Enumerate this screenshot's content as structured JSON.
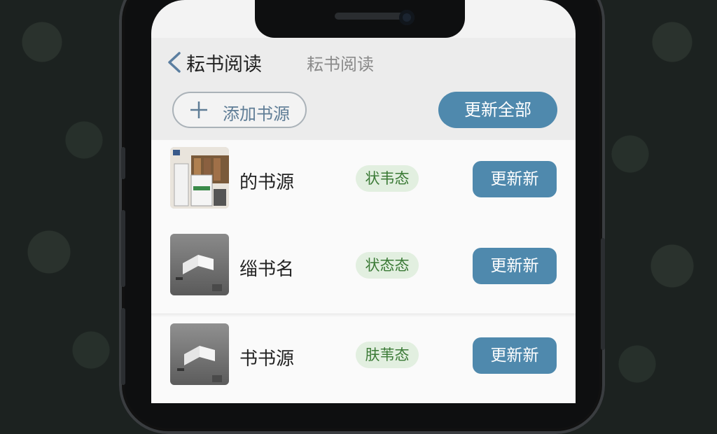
{
  "header": {
    "title": "耘书阅读",
    "subtitle": "耘书阅读",
    "back_icon": "chevron-left-icon",
    "add_source_label": "添加书源",
    "add_icon": "plus-icon",
    "update_all_label": "更新全部"
  },
  "sources": [
    {
      "name": "的书源",
      "status": "状韦态",
      "action": "更新新",
      "thumb": "book-cover-bookshelf"
    },
    {
      "name": "缁书名",
      "status": "状态态",
      "action": "更新新",
      "thumb": "book-cover-open-book"
    },
    {
      "name": "书书源",
      "status": "肤苇态",
      "action": "更新新",
      "thumb": "book-cover-open-book"
    }
  ],
  "colors": {
    "accent": "#4f89ad",
    "badge_bg": "#e2efe0",
    "badge_text": "#3b7a36",
    "background": "#1c2220"
  }
}
